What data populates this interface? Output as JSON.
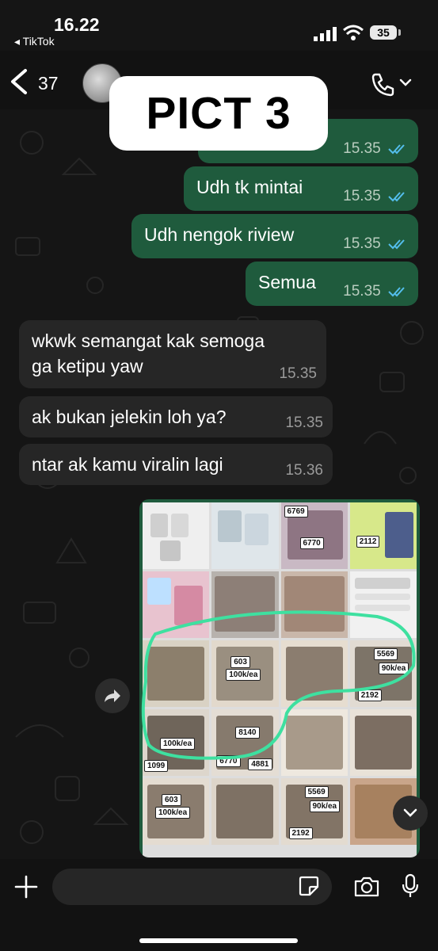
{
  "status_bar": {
    "time": "16.22",
    "back_app": "◂ TikTok",
    "battery": "35"
  },
  "header": {
    "unread_count": "37"
  },
  "overlay_label": "PICT 3",
  "messages": [
    {
      "direction": "out",
      "text": "",
      "time": "15.35",
      "ticks": "read"
    },
    {
      "direction": "out",
      "text": "Udh tk mintai",
      "time": "15.35",
      "ticks": "read"
    },
    {
      "direction": "out",
      "text": "Udh nengok riview",
      "time": "15.35",
      "ticks": "read"
    },
    {
      "direction": "out",
      "text": "Semua",
      "time": "15.35",
      "ticks": "read"
    },
    {
      "direction": "in",
      "text": "wkwk semangat kak semoga\nga ketipu yaw",
      "time": "15.35"
    },
    {
      "direction": "in",
      "text": "ak bukan jelekin loh ya?",
      "time": "15.35"
    },
    {
      "direction": "in",
      "text": "ntar ak kamu viralin lagi",
      "time": "15.36"
    }
  ],
  "image_message": {
    "labels": [
      "6769",
      "6770",
      "2112",
      "603",
      "100k/ea",
      "5569",
      "90k/ea",
      "2192",
      "8140",
      "6770",
      "4881",
      "100k/ea",
      "1099",
      "603",
      "100k/ea",
      "5569",
      "90k/ea",
      "2192"
    ],
    "highlight_color": "#3ee0a0"
  },
  "composer": {
    "placeholder": ""
  },
  "colors": {
    "outgoing_bubble": "#1f5b3d",
    "incoming_bubble": "#262626",
    "read_ticks": "#53bdeb"
  }
}
